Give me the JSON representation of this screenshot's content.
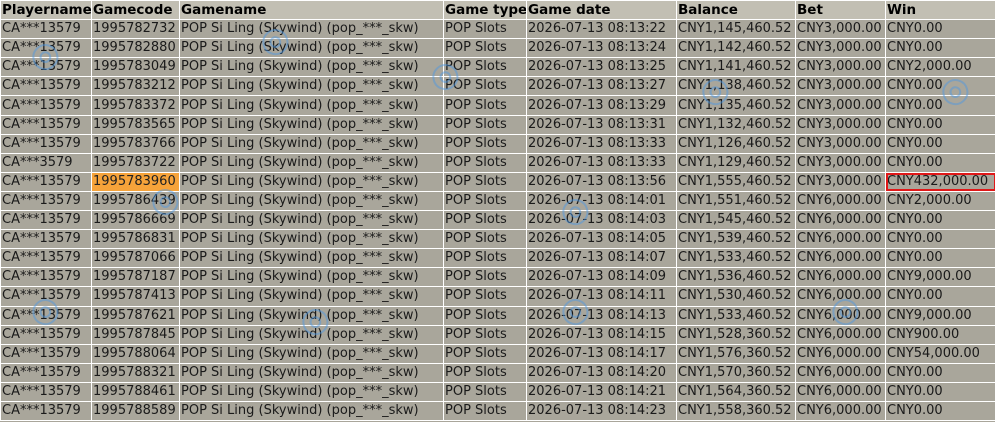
{
  "columns": [
    "Playername",
    "Gamecode",
    "Gamename",
    "Game type",
    "Game date",
    "Balance",
    "Bet",
    "Win"
  ],
  "rows": [
    [
      "CA***13579",
      "1995782732",
      "POP Si Ling (Skywind) (pop_***_skw)",
      "POP Slots",
      "2026-07-13 08:13:22",
      "CNY1,145,460.52",
      "CNY3,000.00",
      "CNY0.00"
    ],
    [
      "CA***13579",
      "1995782880",
      "POP Si Ling (Skywind) (pop_***_skw)",
      "POP Slots",
      "2026-07-13 08:13:24",
      "CNY1,142,460.52",
      "CNY3,000.00",
      "CNY0.00"
    ],
    [
      "CA***13579",
      "1995783049",
      "POP Si Ling (Skywind) (pop_***_skw)",
      "POP Slots",
      "2026-07-13 08:13:25",
      "CNY1,141,460.52",
      "CNY3,000.00",
      "CNY2,000.00"
    ],
    [
      "CA***13579",
      "1995783212",
      "POP Si Ling (Skywind) (pop_***_skw)",
      "POP Slots",
      "2026-07-13 08:13:27",
      "CNY1,138,460.52",
      "CNY3,000.00",
      "CNY0.00"
    ],
    [
      "CA***13579",
      "1995783372",
      "POP Si Ling (Skywind) (pop_***_skw)",
      "POP Slots",
      "2026-07-13 08:13:29",
      "CNY1,135,460.52",
      "CNY3,000.00",
      "CNY0.00"
    ],
    [
      "CA***13579",
      "1995783565",
      "POP Si Ling (Skywind) (pop_***_skw)",
      "POP Slots",
      "2026-07-13 08:13:31",
      "CNY1,132,460.52",
      "CNY3,000.00",
      "CNY0.00"
    ],
    [
      "CA***13579",
      "1995783766",
      "POP Si Ling (Skywind) (pop_***_skw)",
      "POP Slots",
      "2026-07-13 08:13:33",
      "CNY1,126,460.52",
      "CNY3,000.00",
      "CNY0.00"
    ],
    [
      "CA***3579",
      "1995783722",
      "POP Si Ling (Skywind) (pop_***_skw)",
      "POP Slots",
      "2026-07-13 08:13:33",
      "CNY1,129,460.52",
      "CNY3,000.00",
      "CNY0.00"
    ],
    [
      "CA***13579",
      "1995783960",
      "POP Si Ling (Skywind) (pop_***_skw)",
      "POP Slots",
      "2026-07-13 08:13:56",
      "CNY1,555,460.52",
      "CNY3,000.00",
      "CNY432,000.00"
    ],
    [
      "CA***13579",
      "1995786439",
      "POP Si Ling (Skywind) (pop_***_skw)",
      "POP Slots",
      "2026-07-13 08:14:01",
      "CNY1,551,460.52",
      "CNY6,000.00",
      "CNY2,000.00"
    ],
    [
      "CA***13579",
      "1995786669",
      "POP Si Ling (Skywind) (pop_***_skw)",
      "POP Slots",
      "2026-07-13 08:14:03",
      "CNY1,545,460.52",
      "CNY6,000.00",
      "CNY0.00"
    ],
    [
      "CA***13579",
      "1995786831",
      "POP Si Ling (Skywind) (pop_***_skw)",
      "POP Slots",
      "2026-07-13 08:14:05",
      "CNY1,539,460.52",
      "CNY6,000.00",
      "CNY0.00"
    ],
    [
      "CA***13579",
      "1995787066",
      "POP Si Ling (Skywind) (pop_***_skw)",
      "POP Slots",
      "2026-07-13 08:14:07",
      "CNY1,533,460.52",
      "CNY6,000.00",
      "CNY0.00"
    ],
    [
      "CA***13579",
      "1995787187",
      "POP Si Ling (Skywind) (pop_***_skw)",
      "POP Slots",
      "2026-07-13 08:14:09",
      "CNY1,536,460.52",
      "CNY6,000.00",
      "CNY9,000.00"
    ],
    [
      "CA***13579",
      "1995787413",
      "POP Si Ling (Skywind) (pop_***_skw)",
      "POP Slots",
      "2026-07-13 08:14:11",
      "CNY1,530,460.52",
      "CNY6,000.00",
      "CNY0.00"
    ],
    [
      "CA***13579",
      "1995787621",
      "POP Si Ling (Skywind) (pop_***_skw)",
      "POP Slots",
      "2026-07-13 08:14:13",
      "CNY1,533,460.52",
      "CNY6,000.00",
      "CNY9,000.00"
    ],
    [
      "CA***13579",
      "1995787845",
      "POP Si Ling (Skywind) (pop_***_skw)",
      "POP Slots",
      "2026-07-13 08:14:15",
      "CNY1,528,360.52",
      "CNY6,000.00",
      "CNY900.00"
    ],
    [
      "CA***13579",
      "1995788064",
      "POP Si Ling (Skywind) (pop_***_skw)",
      "POP Slots",
      "2026-07-13 08:14:17",
      "CNY1,576,360.52",
      "CNY6,000.00",
      "CNY54,000.00"
    ],
    [
      "CA***13579",
      "1995788321",
      "POP Si Ling (Skywind) (pop_***_skw)",
      "POP Slots",
      "2026-07-13 08:14:20",
      "CNY1,570,360.52",
      "CNY6,000.00",
      "CNY0.00"
    ],
    [
      "CA***13579",
      "1995788461",
      "POP Si Ling (Skywind) (pop_***_skw)",
      "POP Slots",
      "2026-07-13 08:14:21",
      "CNY1,564,360.52",
      "CNY6,000.00",
      "CNY0.00"
    ],
    [
      "CA***13579",
      "1995788589",
      "POP Si Ling (Skywind) (pop_***_skw)",
      "POP Slots",
      "2026-07-13 08:14:23",
      "CNY1,558,360.52",
      "CNY6,000.00",
      "CNY0.00"
    ]
  ],
  "highlight": {
    "row": 8,
    "gamecode_col": 1,
    "win_col": 7,
    "highlight_color": "#f6a33a",
    "box_color": "#e01818"
  },
  "colors": {
    "cell_bg": "#a9a69b",
    "header_bg": "#c2bfb3",
    "grid": "#ffffff"
  }
}
